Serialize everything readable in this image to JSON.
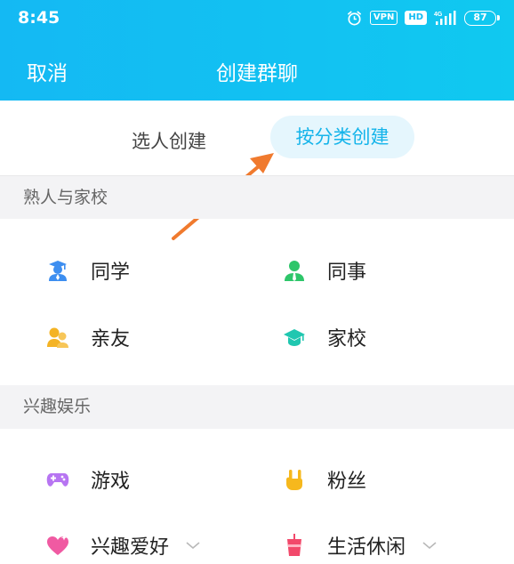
{
  "status_bar": {
    "time": "8:45",
    "vpn": "VPN",
    "hd": "HD",
    "network": "4G",
    "battery": "87"
  },
  "header": {
    "cancel_label": "取消",
    "title": "创建群聊"
  },
  "tabs": [
    {
      "label": "选人创建",
      "active": false
    },
    {
      "label": "按分类创建",
      "active": true
    }
  ],
  "sections": [
    {
      "title": "熟人与家校",
      "items": [
        {
          "label": "同学",
          "icon": "student-icon",
          "color": "#3d8ef0"
        },
        {
          "label": "同事",
          "icon": "colleague-icon",
          "color": "#2ec66a"
        },
        {
          "label": "亲友",
          "icon": "friends-icon",
          "color": "#f4b324"
        },
        {
          "label": "家校",
          "icon": "graduation-cap-icon",
          "color": "#20c7b0"
        }
      ]
    },
    {
      "title": "兴趣娱乐",
      "items": [
        {
          "label": "游戏",
          "icon": "gamepad-icon",
          "color": "#b775f2"
        },
        {
          "label": "粉丝",
          "icon": "rock-hand-icon",
          "color": "#f6b81d"
        },
        {
          "label": "兴趣爱好",
          "icon": "heart-icon",
          "color": "#f05aa2",
          "has_dropdown": true
        },
        {
          "label": "生活休闲",
          "icon": "drink-cup-icon",
          "color": "#f2496b",
          "has_dropdown": true
        }
      ]
    }
  ],
  "colors": {
    "header": "#14b9f3",
    "accent": "#14b4ea",
    "arrow": "#f07a2e"
  }
}
